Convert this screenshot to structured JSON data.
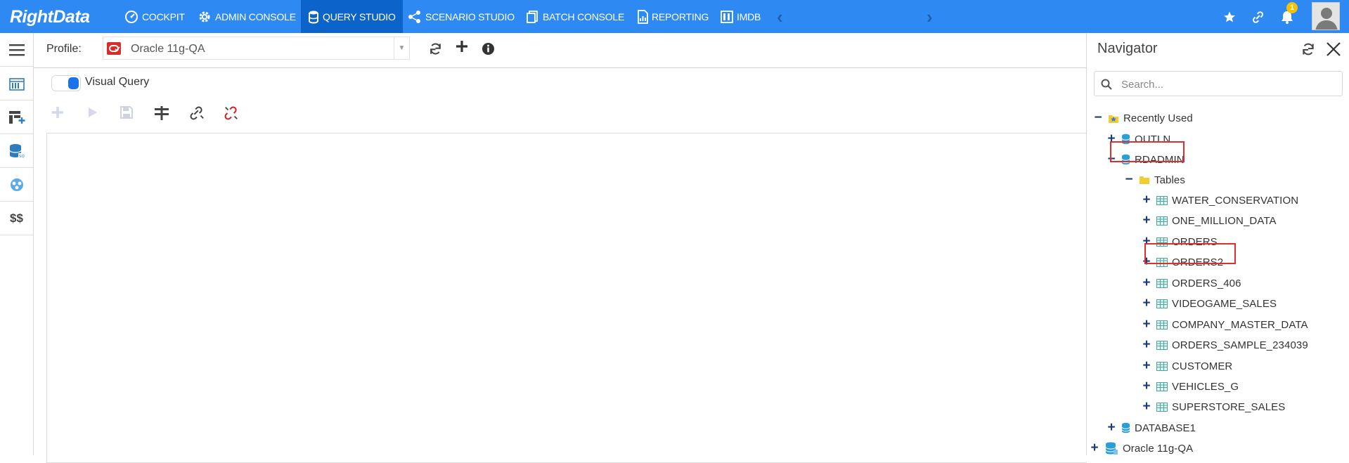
{
  "app": {
    "logo_text": "RightData"
  },
  "nav": {
    "items": [
      {
        "label": "COCKPIT",
        "icon": "cockpit-icon"
      },
      {
        "label": "ADMIN CONSOLE",
        "icon": "gear-icon"
      },
      {
        "label": "QUERY STUDIO",
        "icon": "database-icon",
        "active": true
      },
      {
        "label": "SCENARIO STUDIO",
        "icon": "scenario-icon"
      },
      {
        "label": "BATCH CONSOLE",
        "icon": "batch-icon"
      },
      {
        "label": "REPORTING",
        "icon": "report-icon"
      },
      {
        "label": "IMDB",
        "icon": "imdb-icon"
      }
    ],
    "prev_arrow": "‹",
    "next_arrow": "›",
    "notification_count": "1",
    "right_icons": [
      "star-icon",
      "link-icon",
      "bell-icon",
      "avatar"
    ]
  },
  "colors": {
    "topbar": "#2f89f3",
    "active_tab": "#0c63c9",
    "accent": "#1a73e8",
    "highlight": "#d93030",
    "table_icon": "#45a8a0"
  },
  "left_rail": [
    "catalog-icon",
    "table-add-icon",
    "database-query-icon",
    "schema-icon",
    "dollar-icon"
  ],
  "left_rail_money": "$$",
  "profile": {
    "label": "Profile:",
    "value": "Oracle 11g-QA",
    "caret": "▼"
  },
  "visual_query": {
    "label": "Visual Query",
    "enabled": true
  },
  "toolbar": [
    "add-icon",
    "run-icon",
    "save-icon",
    "filter-icon",
    "link-icon",
    "unlink-icon"
  ],
  "navigator": {
    "title": "Navigator",
    "search_placeholder": "Search...",
    "tree": {
      "recently_used": "Recently Used",
      "outln": "OUTLN",
      "rdadmin": "RDADMIN",
      "tables": "Tables",
      "table_list": [
        "WATER_CONSERVATION",
        "ONE_MILLION_DATA",
        "ORDERS",
        "ORDERS2",
        "ORDERS_406",
        "VIDEOGAME_SALES",
        "COMPANY_MASTER_DATA",
        "ORDERS_SAMPLE_234039",
        "CUSTOMER",
        "VEHICLES_G",
        "SUPERSTORE_SALES"
      ],
      "database1": "DATABASE1",
      "oracle_root": "Oracle 11g-QA",
      "expand_symbol": "+",
      "collapse_symbol": "−"
    }
  }
}
